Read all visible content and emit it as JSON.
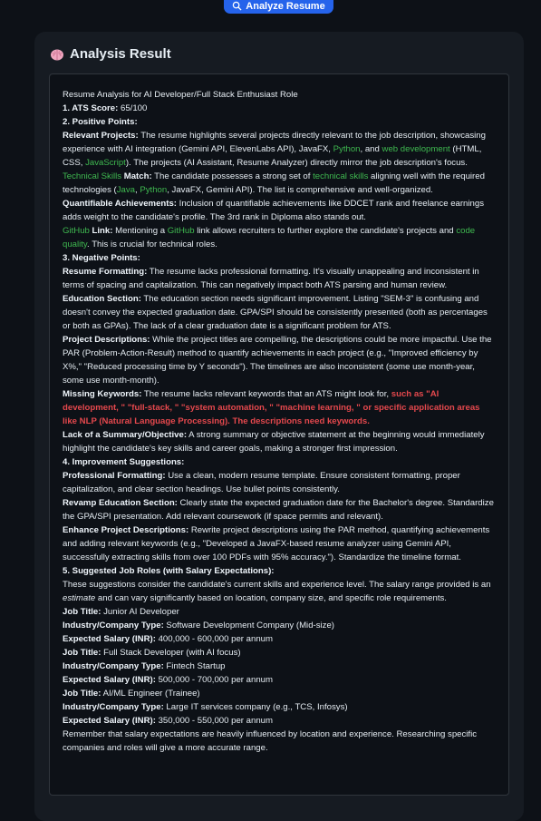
{
  "analyze_button": {
    "label": "Analyze Resume"
  },
  "card": {
    "title": "Analysis Result",
    "icon": "brain-icon"
  },
  "colors": {
    "accent": "#2563eb",
    "positive": "#3fb950",
    "negative": "#e5484d",
    "background": "#0d1117",
    "card": "#161b22"
  },
  "lines": [
    [
      {
        "t": "Resume Analysis for AI Developer/Full Stack Enthusiast Role"
      }
    ],
    [
      {
        "t": "1. ATS Score:",
        "s": "b"
      },
      {
        "t": " 65/100"
      }
    ],
    [
      {
        "t": "2. Positive Points:",
        "s": "b"
      }
    ],
    [
      {
        "t": "Relevant Projects:",
        "s": "b"
      },
      {
        "t": " The resume highlights several projects directly relevant to the job description, showcasing experience with AI integration (Gemini API, ElevenLabs API), JavaFX, "
      },
      {
        "t": "Python",
        "s": "g"
      },
      {
        "t": ", and "
      },
      {
        "t": "web development",
        "s": "g"
      },
      {
        "t": " (HTML, CSS, "
      },
      {
        "t": "JavaScript",
        "s": "g"
      },
      {
        "t": "). The projects (AI Assistant, Resume Analyzer) directly mirror the job description's focus."
      }
    ],
    [
      {
        "t": "Technical Skills",
        "s": "g"
      },
      {
        "t": " Match:",
        "s": "b"
      },
      {
        "t": " The candidate possesses a strong set of "
      },
      {
        "t": "technical skills",
        "s": "g"
      },
      {
        "t": " aligning well with the required technologies ("
      },
      {
        "t": "Java",
        "s": "g"
      },
      {
        "t": ", "
      },
      {
        "t": "Python",
        "s": "g"
      },
      {
        "t": ", JavaFX, Gemini API). The list is comprehensive and well-organized."
      }
    ],
    [
      {
        "t": "Quantifiable Achievements:",
        "s": "b"
      },
      {
        "t": " Inclusion of quantifiable achievements like DDCET rank and freelance earnings adds weight to the candidate's profile. The 3rd rank in Diploma also stands out."
      }
    ],
    [
      {
        "t": "GitHub",
        "s": "g"
      },
      {
        "t": " Link:",
        "s": "b"
      },
      {
        "t": " Mentioning a "
      },
      {
        "t": "GitHub",
        "s": "g"
      },
      {
        "t": " link allows recruiters to further explore the candidate's projects and "
      },
      {
        "t": "code quality",
        "s": "g"
      },
      {
        "t": ". This is crucial for technical roles."
      }
    ],
    [
      {
        "t": "3. Negative Points:",
        "s": "b"
      }
    ],
    [
      {
        "t": "Resume Formatting:",
        "s": "b"
      },
      {
        "t": " The resume lacks professional formatting. It's visually unappealing and inconsistent in terms of spacing and capitalization. This can negatively impact both ATS parsing and human review."
      }
    ],
    [
      {
        "t": "Education Section:",
        "s": "b"
      },
      {
        "t": " The education section needs significant improvement. Listing \"SEM-3\" is confusing and doesn't convey the expected graduation date. GPA/SPI should be consistently presented (both as percentages or both as GPAs). The lack of a clear graduation date is a significant problem for ATS."
      }
    ],
    [
      {
        "t": "Project Descriptions:",
        "s": "b"
      },
      {
        "t": " While the project titles are compelling, the descriptions could be more impactful. Use the PAR (Problem-Action-Result) method to quantify achievements in each project (e.g., \"Improved efficiency by X%,\" \"Reduced processing time by Y seconds\"). The timelines are also inconsistent (some use month-year, some use month-month)."
      }
    ],
    [
      {
        "t": "Missing Keywords:",
        "s": "b"
      },
      {
        "t": " The resume lacks relevant keywords that an ATS might look for, "
      },
      {
        "t": "such as \"AI development, \" \"full-stack, \" \"system automation, \" \"machine learning, \" or specific application areas like NLP (Natural Language Processing). The descriptions need keywords.",
        "s": "r"
      }
    ],
    [
      {
        "t": "Lack of a Summary/Objective:",
        "s": "b"
      },
      {
        "t": " A strong summary or objective statement at the beginning would immediately highlight the candidate's key skills and career goals, making a stronger first impression."
      }
    ],
    [
      {
        "t": "4. Improvement Suggestions:",
        "s": "b"
      }
    ],
    [
      {
        "t": "Professional Formatting:",
        "s": "b"
      },
      {
        "t": " Use a clean, modern resume template. Ensure consistent formatting, proper capitalization, and clear section headings. Use bullet points consistently."
      }
    ],
    [
      {
        "t": "Revamp Education Section:",
        "s": "b"
      },
      {
        "t": " Clearly state the expected graduation date for the Bachelor's degree. Standardize the GPA/SPI presentation. Add relevant coursework (if space permits and relevant)."
      }
    ],
    [
      {
        "t": "Enhance Project Descriptions:",
        "s": "b"
      },
      {
        "t": " Rewrite project descriptions using the PAR method, quantifying achievements and adding relevant keywords (e.g., \"Developed a JavaFX-based resume analyzer using Gemini API, successfully extracting skills from over 100 PDFs with 95% accuracy.\"). Standardize the timeline format."
      }
    ],
    [
      {
        "t": "5. Suggested Job Roles (with Salary Expectations):",
        "s": "b"
      }
    ],
    [
      {
        "t": "These suggestions consider the candidate's current skills and experience level. The salary range provided is an "
      },
      {
        "t": "estimate",
        "s": "i"
      },
      {
        "t": " and can vary significantly based on location, company size, and specific role requirements."
      }
    ],
    [
      {
        "t": "Job Title:",
        "s": "b"
      },
      {
        "t": " Junior AI Developer"
      }
    ],
    [
      {
        "t": "Industry/Company Type:",
        "s": "b"
      },
      {
        "t": " Software Development Company (Mid-size)"
      }
    ],
    [
      {
        "t": "Expected Salary (INR):",
        "s": "b"
      },
      {
        "t": " 400,000 - 600,000 per annum"
      }
    ],
    [
      {
        "t": "Job Title:",
        "s": "b"
      },
      {
        "t": " Full Stack Developer (with AI focus)"
      }
    ],
    [
      {
        "t": "Industry/Company Type:",
        "s": "b"
      },
      {
        "t": " Fintech Startup"
      }
    ],
    [
      {
        "t": "Expected Salary (INR):",
        "s": "b"
      },
      {
        "t": " 500,000 - 700,000 per annum"
      }
    ],
    [
      {
        "t": "Job Title:",
        "s": "b"
      },
      {
        "t": " AI/ML Engineer (Trainee)"
      }
    ],
    [
      {
        "t": "Industry/Company Type:",
        "s": "b"
      },
      {
        "t": " Large IT services company (e.g., TCS, Infosys)"
      }
    ],
    [
      {
        "t": "Expected Salary (INR):",
        "s": "b"
      },
      {
        "t": " 350,000 - 550,000 per annum"
      }
    ],
    [
      {
        "t": "Remember that salary expectations are heavily influenced by location and experience. Researching specific companies and roles will give a more accurate range."
      }
    ]
  ]
}
